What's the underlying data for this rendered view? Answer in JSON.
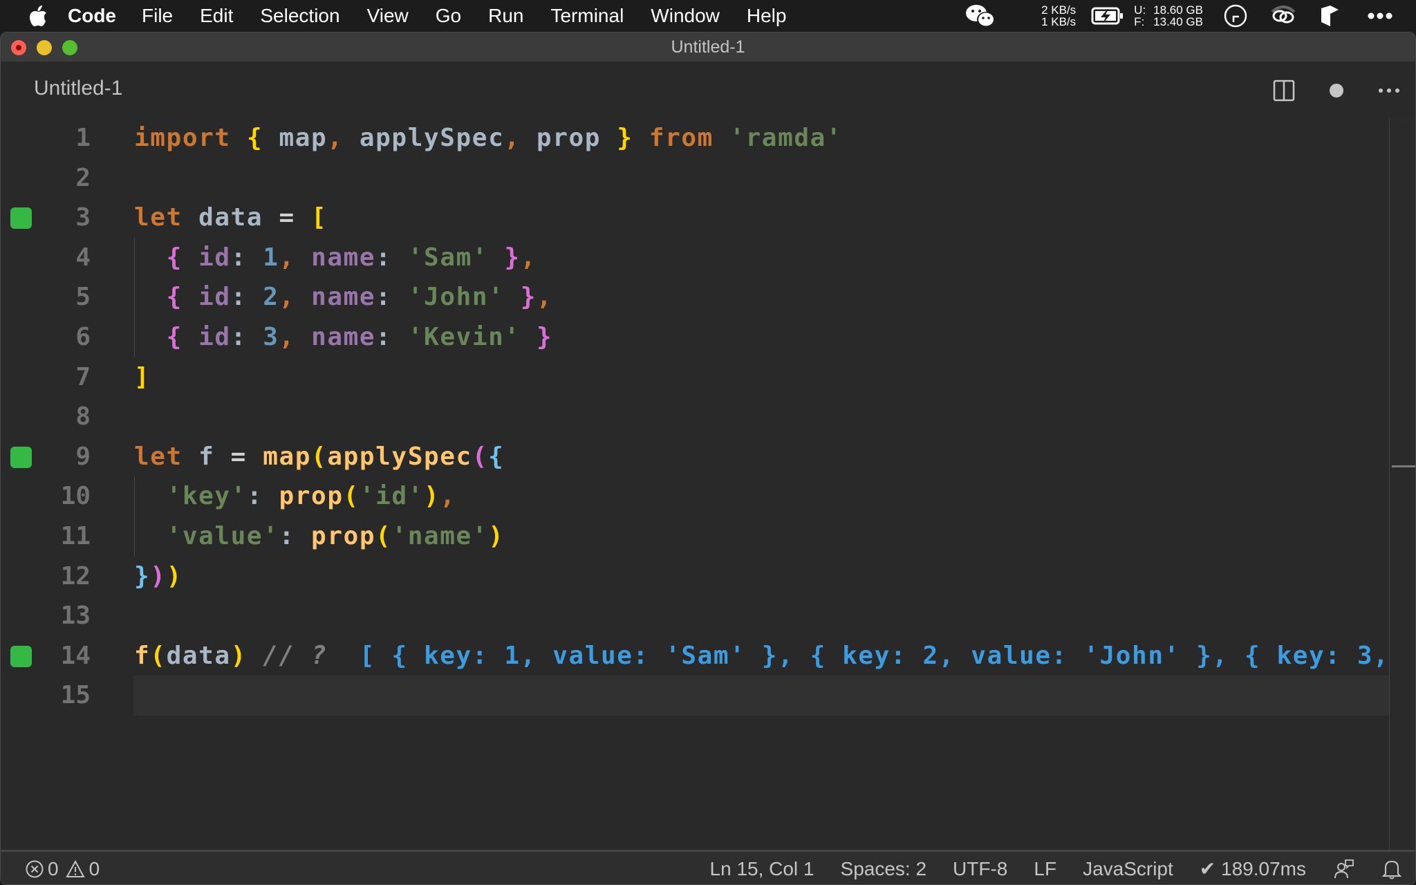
{
  "menubar": {
    "apple_icon": "apple-logo-icon",
    "app_name": "Code",
    "items": [
      "File",
      "Edit",
      "Selection",
      "View",
      "Go",
      "Run",
      "Terminal",
      "Window",
      "Help"
    ],
    "tray": {
      "wechat_icon": "wechat-icon",
      "net_up": "2 KB/s",
      "net_down": "1 KB/s",
      "battery_icon": "battery-charging-icon",
      "mem_used_label": "U:",
      "mem_used": "18.60 GB",
      "mem_free_label": "F:",
      "mem_free": "13.40 GB",
      "clock_icon": "clock-icon",
      "link_icon": "link-icon",
      "app_icon": "app-tray-icon",
      "more_icon": "more-icon"
    }
  },
  "window": {
    "title": "Untitled-1",
    "traffic_lights": {
      "close": "#fe5f57",
      "minimize": "#e8c12f",
      "maximize": "#54c02f"
    }
  },
  "tab": {
    "label": "Untitled-1",
    "actions": [
      "split-editor-icon",
      "unsaved-dot-icon",
      "more-actions-icon"
    ]
  },
  "editor": {
    "current_line": 15,
    "lines": [
      {
        "n": "1",
        "deco": false,
        "tokens": [
          [
            "kw",
            "import"
          ],
          [
            "id",
            " "
          ],
          [
            "b1",
            "{"
          ],
          [
            "id",
            " map"
          ],
          [
            "punc",
            ","
          ],
          [
            "id",
            " applySpec"
          ],
          [
            "punc",
            ","
          ],
          [
            "id",
            " prop "
          ],
          [
            "b1",
            "}"
          ],
          [
            "id",
            " "
          ],
          [
            "kw",
            "from"
          ],
          [
            "id",
            " "
          ],
          [
            "str",
            "'ramda'"
          ]
        ]
      },
      {
        "n": "2",
        "deco": false,
        "tokens": []
      },
      {
        "n": "3",
        "deco": true,
        "tokens": [
          [
            "kw",
            "let"
          ],
          [
            "id",
            " data "
          ],
          [
            "op",
            "="
          ],
          [
            "id",
            " "
          ],
          [
            "b1",
            "["
          ]
        ]
      },
      {
        "n": "4",
        "deco": false,
        "tokens": [
          [
            "id",
            "  "
          ],
          [
            "b2",
            "{"
          ],
          [
            "id",
            " "
          ],
          [
            "prop",
            "id"
          ],
          [
            "colon",
            ":"
          ],
          [
            "id",
            " "
          ],
          [
            "num",
            "1"
          ],
          [
            "punc",
            ","
          ],
          [
            "id",
            " "
          ],
          [
            "prop",
            "name"
          ],
          [
            "colon",
            ":"
          ],
          [
            "id",
            " "
          ],
          [
            "str",
            "'Sam'"
          ],
          [
            "id",
            " "
          ],
          [
            "b2",
            "}"
          ],
          [
            "punc",
            ","
          ]
        ]
      },
      {
        "n": "5",
        "deco": false,
        "tokens": [
          [
            "id",
            "  "
          ],
          [
            "b2",
            "{"
          ],
          [
            "id",
            " "
          ],
          [
            "prop",
            "id"
          ],
          [
            "colon",
            ":"
          ],
          [
            "id",
            " "
          ],
          [
            "num",
            "2"
          ],
          [
            "punc",
            ","
          ],
          [
            "id",
            " "
          ],
          [
            "prop",
            "name"
          ],
          [
            "colon",
            ":"
          ],
          [
            "id",
            " "
          ],
          [
            "str",
            "'John'"
          ],
          [
            "id",
            " "
          ],
          [
            "b2",
            "}"
          ],
          [
            "punc",
            ","
          ]
        ]
      },
      {
        "n": "6",
        "deco": false,
        "tokens": [
          [
            "id",
            "  "
          ],
          [
            "b2",
            "{"
          ],
          [
            "id",
            " "
          ],
          [
            "prop",
            "id"
          ],
          [
            "colon",
            ":"
          ],
          [
            "id",
            " "
          ],
          [
            "num",
            "3"
          ],
          [
            "punc",
            ","
          ],
          [
            "id",
            " "
          ],
          [
            "prop",
            "name"
          ],
          [
            "colon",
            ":"
          ],
          [
            "id",
            " "
          ],
          [
            "str",
            "'Kevin'"
          ],
          [
            "id",
            " "
          ],
          [
            "b2",
            "}"
          ]
        ]
      },
      {
        "n": "7",
        "deco": false,
        "tokens": [
          [
            "b1",
            "]"
          ]
        ]
      },
      {
        "n": "8",
        "deco": false,
        "tokens": []
      },
      {
        "n": "9",
        "deco": true,
        "tokens": [
          [
            "kw",
            "let"
          ],
          [
            "id",
            " f "
          ],
          [
            "op",
            "="
          ],
          [
            "id",
            " "
          ],
          [
            "fn",
            "map"
          ],
          [
            "b1",
            "("
          ],
          [
            "fn",
            "applySpec"
          ],
          [
            "b2",
            "("
          ],
          [
            "b3l",
            "{"
          ]
        ]
      },
      {
        "n": "10",
        "deco": false,
        "tokens": [
          [
            "id",
            "  "
          ],
          [
            "str",
            "'key'"
          ],
          [
            "colon",
            ":"
          ],
          [
            "id",
            " "
          ],
          [
            "fn",
            "prop"
          ],
          [
            "b1",
            "("
          ],
          [
            "str",
            "'id'"
          ],
          [
            "b1",
            ")"
          ],
          [
            "punc",
            ","
          ]
        ]
      },
      {
        "n": "11",
        "deco": false,
        "tokens": [
          [
            "id",
            "  "
          ],
          [
            "str",
            "'value'"
          ],
          [
            "colon",
            ":"
          ],
          [
            "id",
            " "
          ],
          [
            "fn",
            "prop"
          ],
          [
            "b1",
            "("
          ],
          [
            "str",
            "'name'"
          ],
          [
            "b1",
            ")"
          ]
        ]
      },
      {
        "n": "12",
        "deco": false,
        "tokens": [
          [
            "b3l",
            "}"
          ],
          [
            "b2",
            ")"
          ],
          [
            "b1",
            ")"
          ]
        ]
      },
      {
        "n": "13",
        "deco": false,
        "tokens": []
      },
      {
        "n": "14",
        "deco": true,
        "tokens": [
          [
            "fn",
            "f"
          ],
          [
            "b1",
            "("
          ],
          [
            "id",
            "data"
          ],
          [
            "b1",
            ")"
          ],
          [
            "id",
            " "
          ],
          [
            "comment",
            "// ?"
          ],
          [
            "id",
            "  "
          ],
          [
            "result",
            "[ { key: 1, value: 'Sam' }, { key: 2, value: 'John' }, { key: 3,"
          ]
        ]
      },
      {
        "n": "15",
        "deco": false,
        "tokens": []
      }
    ]
  },
  "statusbar": {
    "errors_icon": "error-circle-icon",
    "errors": "0",
    "warnings_icon": "warning-triangle-icon",
    "warnings": "0",
    "position": "Ln 15, Col 1",
    "spaces": "Spaces: 2",
    "encoding": "UTF-8",
    "eol": "LF",
    "language": "JavaScript",
    "timing": "✔ 189.07ms",
    "feedback_icon": "feedback-icon",
    "notifications_icon": "bell-icon"
  }
}
